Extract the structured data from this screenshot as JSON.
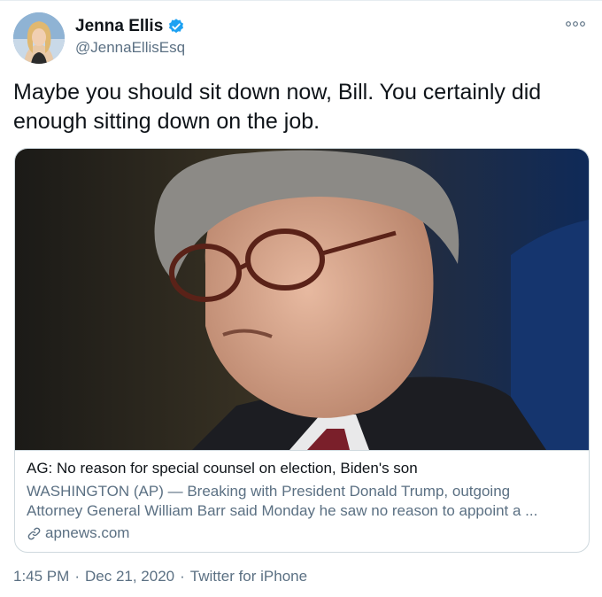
{
  "author": {
    "name": "Jenna Ellis",
    "handle": "@JennaEllisEsq",
    "verified": true,
    "avatar_icon": "profile-photo"
  },
  "tweet": {
    "text": "Maybe you should sit down now, Bill. You certainly did enough sitting down on the job."
  },
  "card": {
    "image_icon": "news-photo",
    "title": "AG: No reason for special counsel on election, Biden's son",
    "description_line1": "WASHINGTON (AP) — Breaking with President Donald Trump, outgoing",
    "description_line2": "Attorney General William Barr said Monday he saw no reason to appoint a ...",
    "domain": "apnews.com",
    "link_icon": "link-icon"
  },
  "meta": {
    "time": "1:45 PM",
    "separator": "·",
    "date": "Dec 21, 2020",
    "source": "Twitter for iPhone"
  },
  "colors": {
    "text": "#0f1419",
    "secondary": "#5b7083",
    "verified": "#1da1f2",
    "border": "#cfd9de"
  }
}
